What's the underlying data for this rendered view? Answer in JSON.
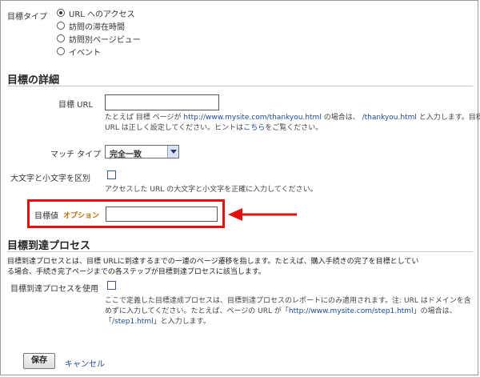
{
  "goal_type": {
    "label": "目標タイプ",
    "options": [
      {
        "label": "URL へのアクセス",
        "checked": true
      },
      {
        "label": "訪問の滞在時間",
        "checked": false
      },
      {
        "label": "訪問別ページビュー",
        "checked": false
      },
      {
        "label": "イベント",
        "checked": false
      }
    ]
  },
  "details": {
    "title": "目標の詳細",
    "goal_url": {
      "label": "目標 URL",
      "value": "",
      "help_prefix": "たとえば 目標 ページが",
      "help_example": "http://www.mysite.com/thankyou.html",
      "help_mid": "の場合は、",
      "help_path": "/thankyou.html",
      "help_suffix": "と入力します。目標",
      "help_line2": "URL は正しく設定してください。ヒントは",
      "help_link": "こちら",
      "help_end": "をご覧ください。"
    },
    "match_type": {
      "label": "マッチ タイプ",
      "value": "完全一致"
    },
    "case_sensitive": {
      "label": "大文字と小文字を区別",
      "checked": false,
      "help": "アクセスした URL の大文字と小文字を正確に入力してください。"
    },
    "goal_value": {
      "label": "目標値",
      "optional": "オプション",
      "value": ""
    }
  },
  "funnel": {
    "title": "目標到達プロセス",
    "desc_line1": "目標到達プロセスとは、目標 URLに到達するまでの一連のページ遷移を指します。たとえば、購入手続きの完了を目標としてい",
    "desc_line2": "る場合、手続き完了ページまでの各ステップが目標到達プロセスに該当します。",
    "use_label": "目標到達プロセスを使用",
    "use_checked": false,
    "help_line1": "ここで定義した目標達成プロセスは、目標到達プロセスのレポートにのみ適用されます。注: URL はドメインを含",
    "help_line2_prefix": "めずに入力してください。たとえば、ページの URL が「",
    "help_line2_url": "http://www.mysite.com/step1.html",
    "help_line2_suffix": "」の場合は、",
    "help_line3_prefix": "「",
    "help_line3_path": "/step1.html",
    "help_line3_suffix": "」と入力します。"
  },
  "actions": {
    "save": "保存",
    "cancel": "キャンセル"
  },
  "colors": {
    "highlight": "#e3100f",
    "link": "#1a4a99",
    "optional": "#b86e00"
  }
}
